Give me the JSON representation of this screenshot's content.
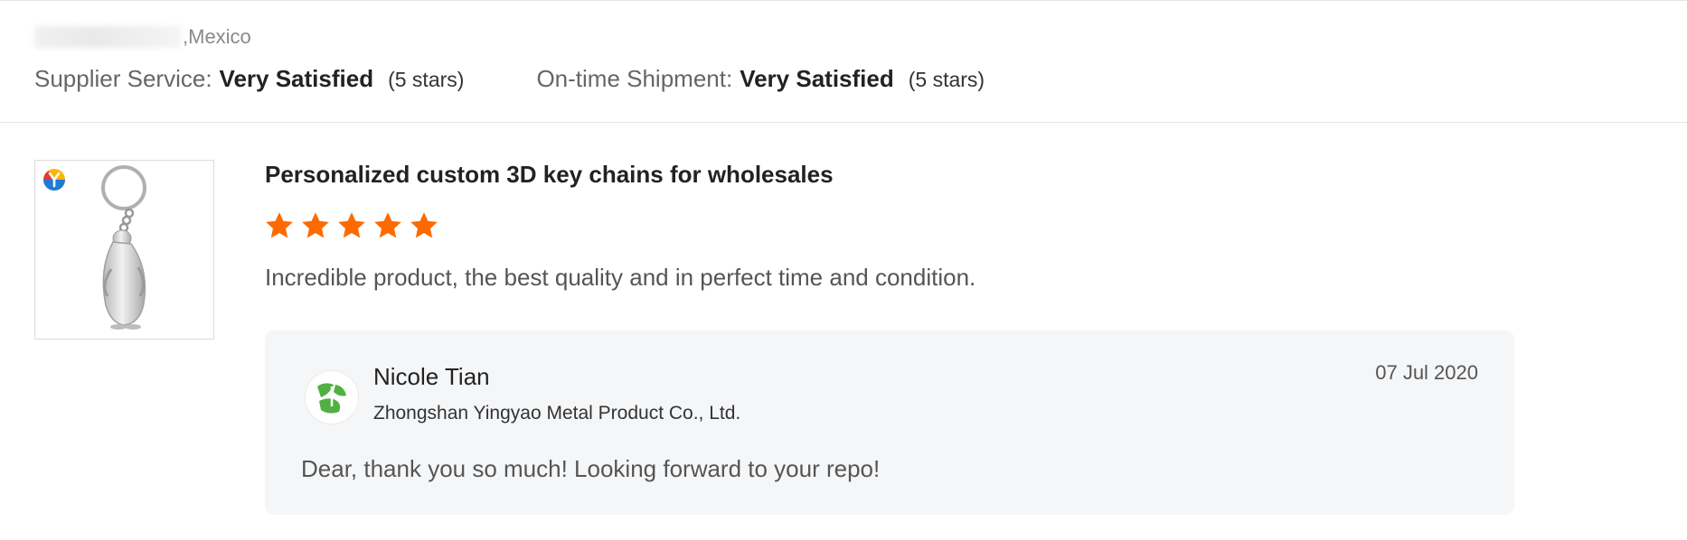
{
  "reviewer": {
    "location": ",Mexico"
  },
  "ratings": [
    {
      "label": "Supplier Service:",
      "value": "Very Satisfied",
      "stars": "(5 stars)"
    },
    {
      "label": "On-time Shipment:",
      "value": "Very Satisfied",
      "stars": "(5 stars)"
    }
  ],
  "product": {
    "title": "Personalized custom 3D key chains for wholesales",
    "image_icon": "penguin-keychain-photo",
    "badge_icon": "brand-logo-icon",
    "rating": 5,
    "rating_max": 5,
    "star_color": "#ff6a00"
  },
  "review": {
    "text": "Incredible product, the best quality and in perfect time and condition."
  },
  "reply": {
    "name": "Nicole Tian",
    "company": "Zhongshan Yingyao Metal Product Co., Ltd.",
    "date": "07 Jul 2020",
    "text": "Dear, thank you so much! Looking forward to your repo!",
    "avatar_color": "#52b043"
  }
}
